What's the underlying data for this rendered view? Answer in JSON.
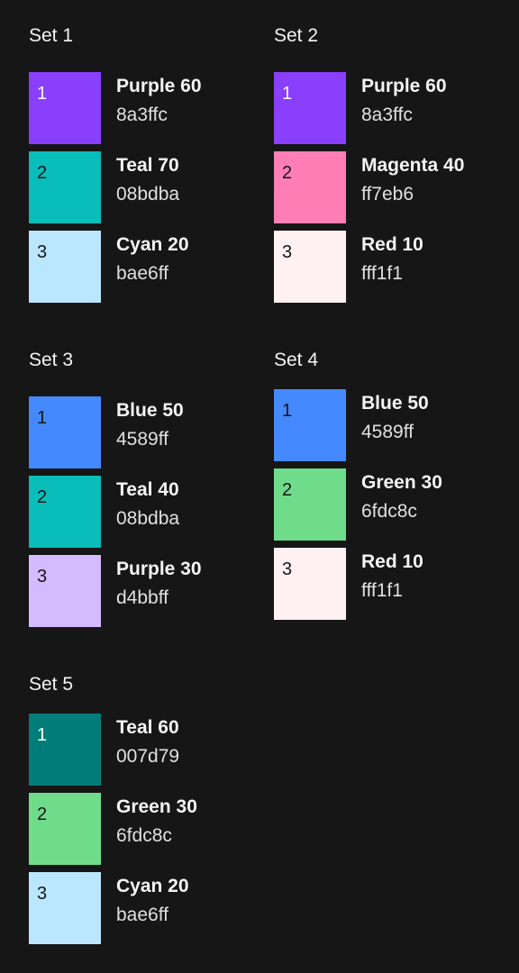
{
  "sets": [
    {
      "title": "Set 1",
      "swatches": [
        {
          "number": "1",
          "name": "Purple 60",
          "hex": "8a3ffc",
          "color": "#8a3ffc",
          "number_color": "#ffffff"
        },
        {
          "number": "2",
          "name": "Teal 70",
          "hex": "08bdba",
          "color": "#08bdba",
          "number_color": "#161616"
        },
        {
          "number": "3",
          "name": "Cyan 20",
          "hex": "bae6ff",
          "color": "#bae6ff",
          "number_color": "#161616"
        }
      ]
    },
    {
      "title": "Set 2",
      "swatches": [
        {
          "number": "1",
          "name": "Purple 60",
          "hex": "8a3ffc",
          "color": "#8a3ffc",
          "number_color": "#ffffff"
        },
        {
          "number": "2",
          "name": "Magenta 40",
          "hex": "ff7eb6",
          "color": "#ff7eb6",
          "number_color": "#161616"
        },
        {
          "number": "3",
          "name": "Red 10",
          "hex": "fff1f1",
          "color": "#fff1f1",
          "number_color": "#161616"
        }
      ]
    },
    {
      "title": "Set 3",
      "swatches": [
        {
          "number": "1",
          "name": "Blue 50",
          "hex": "4589ff",
          "color": "#4589ff",
          "number_color": "#161616"
        },
        {
          "number": "2",
          "name": "Teal 40",
          "hex": "08bdba",
          "color": "#08bdba",
          "number_color": "#161616"
        },
        {
          "number": "3",
          "name": "Purple 30",
          "hex": "d4bbff",
          "color": "#d4bbff",
          "number_color": "#161616"
        }
      ]
    },
    {
      "title": "Set 4",
      "swatches": [
        {
          "number": "1",
          "name": "Blue 50",
          "hex": "4589ff",
          "color": "#4589ff",
          "number_color": "#161616"
        },
        {
          "number": "2",
          "name": "Green 30",
          "hex": "6fdc8c",
          "color": "#6fdc8c",
          "number_color": "#161616"
        },
        {
          "number": "3",
          "name": "Red 10",
          "hex": "fff1f1",
          "color": "#fff1f1",
          "number_color": "#161616"
        }
      ]
    },
    {
      "title": "Set 5",
      "swatches": [
        {
          "number": "1",
          "name": "Teal 60",
          "hex": "007d79",
          "color": "#007d79",
          "number_color": "#ffffff"
        },
        {
          "number": "2",
          "name": "Green 30",
          "hex": "6fdc8c",
          "color": "#6fdc8c",
          "number_color": "#161616"
        },
        {
          "number": "3",
          "name": "Cyan 20",
          "hex": "bae6ff",
          "color": "#bae6ff",
          "number_color": "#161616"
        }
      ]
    }
  ]
}
